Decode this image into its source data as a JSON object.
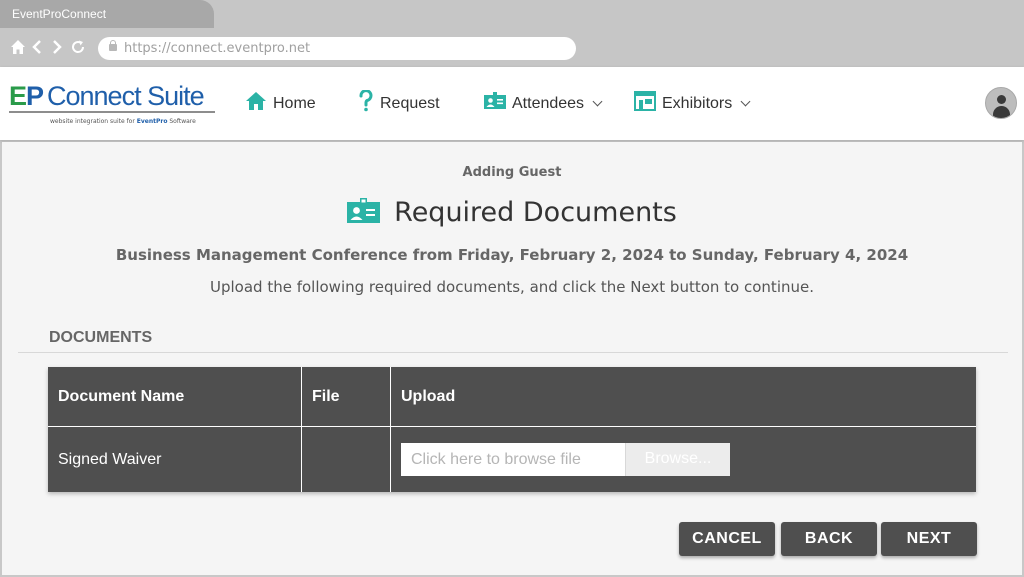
{
  "browser": {
    "tab_title": "EventProConnect",
    "url": "https://connect.eventpro.net"
  },
  "logo": {
    "ep": "EP",
    "name": "Connect Suite",
    "tagline_prefix": "website integration suite for",
    "tagline_brand": "EventPro",
    "tagline_suffix": "Software"
  },
  "nav": {
    "home": "Home",
    "request": "Request",
    "attendees": "Attendees",
    "exhibitors": "Exhibitors"
  },
  "page": {
    "mode": "Adding Guest",
    "title": "Required Documents",
    "event": "Business Management Conference from Friday, February 2, 2024 to Sunday, February 4, 2024",
    "instructions": "Upload the following required documents, and click the Next button to continue."
  },
  "documents": {
    "heading": "DOCUMENTS",
    "columns": [
      "Document Name",
      "File",
      "Upload"
    ],
    "rows": [
      {
        "name": "Signed Waiver",
        "file": "",
        "placeholder": "Click here to browse file",
        "browse_label": "Browse..."
      }
    ]
  },
  "actions": {
    "cancel": "CANCEL",
    "back": "BACK",
    "next": "NEXT"
  },
  "colors": {
    "accent_teal": "#2bb3a6",
    "dark_button": "#4f4f4f",
    "brand_blue": "#1f5faa",
    "brand_green": "#2a9b4a"
  }
}
